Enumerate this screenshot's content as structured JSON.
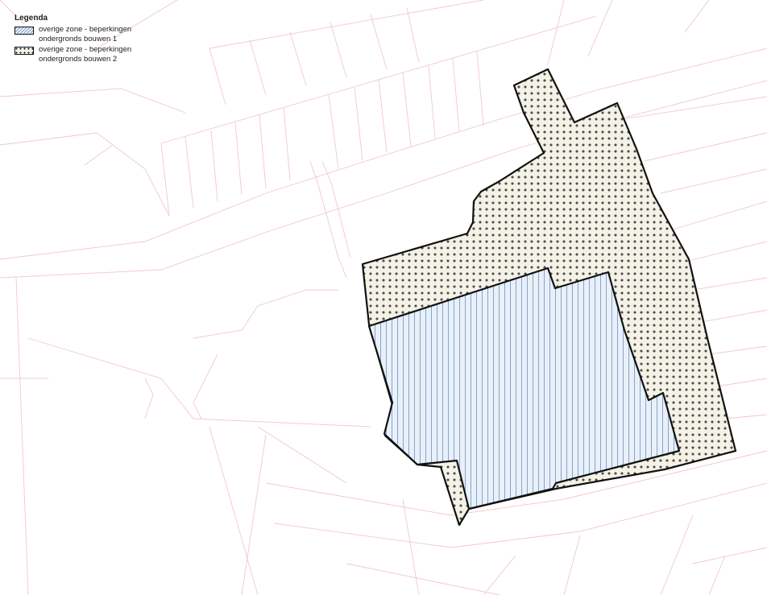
{
  "legend": {
    "title": "Legenda",
    "items": [
      {
        "line1": "overige zone - beperkingen",
        "line2": "ondergronds bouwen 1",
        "pattern": "vertical-hatch-blue"
      },
      {
        "line1": "overige zone - beperkingen",
        "line2": "ondergronds bouwen 2",
        "pattern": "cross-dots-black"
      }
    ]
  },
  "colors": {
    "parcel_lines": "#f0c8cc",
    "zone_outline": "#111111",
    "zone1_fill": "#e8f0f8",
    "zone1_hatch": "#6f8fc8",
    "zone2_fill": "#f4f2e6",
    "zone2_mark": "#111111"
  }
}
